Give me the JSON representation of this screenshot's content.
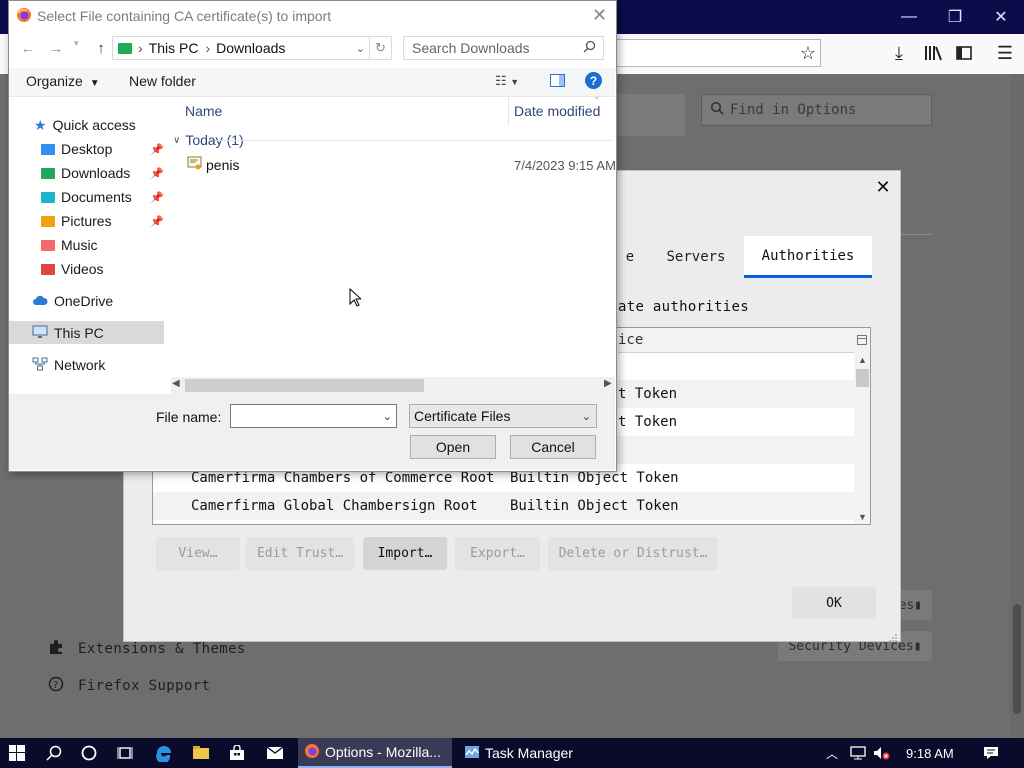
{
  "browser": {
    "window_controls": {
      "minimize": "—",
      "restore": "❐",
      "close": "✕"
    }
  },
  "options_page": {
    "find_placeholder": "Find in Options",
    "links": [
      {
        "label": "Extensions & Themes",
        "icon": "puzzle-icon"
      },
      {
        "label": "Firefox Support",
        "icon": "help-circle-icon"
      }
    ],
    "security_devices_label": "Security Devices",
    "partial_button_label": "es"
  },
  "cert_manager": {
    "tabs": [
      {
        "label": "e",
        "active": false
      },
      {
        "label": "Servers",
        "active": false
      },
      {
        "label": "Authorities",
        "active": true
      }
    ],
    "description": "ate authorities",
    "column_header": "ice",
    "rows": [
      {
        "name": "",
        "token": ""
      },
      {
        "name": "",
        "token": "t Token"
      },
      {
        "name": "",
        "token": "t Token"
      },
      {
        "name": "",
        "token": ""
      },
      {
        "name": "Camerfirma Chambers of Commerce Root",
        "token": "Builtin Object Token"
      },
      {
        "name": "Camerfirma Global Chambersign Root",
        "token": "Builtin Object Token"
      }
    ],
    "buttons": {
      "view": "View…",
      "edit_trust": "Edit Trust…",
      "import": "Import…",
      "export": "Export…",
      "delete": "Delete or Distrust…",
      "ok": "OK"
    }
  },
  "file_dialog": {
    "title": "Select File containing CA certificate(s) to import",
    "path": [
      "This PC",
      "Downloads"
    ],
    "search_placeholder": "Search Downloads",
    "toolbar": {
      "organize": "Organize",
      "new_folder": "New folder"
    },
    "nav": [
      {
        "label": "Quick access",
        "icon": "star-icon",
        "indent": 0
      },
      {
        "label": "Desktop",
        "icon": "desktop-folder-icon",
        "indent": 1,
        "pinned": true,
        "color": "#2f8ff0"
      },
      {
        "label": "Downloads",
        "icon": "downloads-folder-icon",
        "indent": 1,
        "pinned": true,
        "color": "#1faa59"
      },
      {
        "label": "Documents",
        "icon": "documents-folder-icon",
        "indent": 1,
        "pinned": true,
        "color": "#21b4c6"
      },
      {
        "label": "Pictures",
        "icon": "pictures-folder-icon",
        "indent": 1,
        "pinned": true,
        "color": "#f0a30a"
      },
      {
        "label": "Music",
        "icon": "music-folder-icon",
        "indent": 1,
        "pinned": false,
        "color": "#f06a6a"
      },
      {
        "label": "Videos",
        "icon": "videos-folder-icon",
        "indent": 1,
        "pinned": false,
        "color": "#e04444"
      },
      {
        "label": "OneDrive",
        "icon": "cloud-icon",
        "indent": 0
      },
      {
        "label": "This PC",
        "icon": "computer-icon",
        "indent": 0,
        "selected": true
      },
      {
        "label": "Network",
        "icon": "network-icon",
        "indent": 0
      }
    ],
    "columns": {
      "name": "Name",
      "date_modified": "Date modified"
    },
    "group_label": "Today (1)",
    "files": [
      {
        "name": "penis",
        "date": "7/4/2023 9:15 AM"
      }
    ],
    "file_name_label": "File name:",
    "file_name_value": "",
    "file_type": "Certificate Files",
    "open_button": "Open",
    "cancel_button": "Cancel"
  },
  "taskbar": {
    "apps": [
      {
        "label": "Options - Mozilla...",
        "icon": "firefox-icon",
        "active": true
      },
      {
        "label": "Task Manager",
        "icon": "task-manager-icon",
        "active": false
      }
    ],
    "clock": "9:18 AM"
  }
}
